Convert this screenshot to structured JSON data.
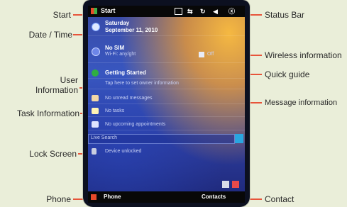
{
  "callouts": {
    "start": "Start",
    "date_time": "Date / Time",
    "user_information_line1": "User",
    "user_information_line2": "Information",
    "task_information": "Task Information",
    "lock_screen": "Lock Screen",
    "phone": "Phone",
    "status_bar": "Status Bar",
    "wireless_information": "Wireless information",
    "quick_guide": "Quick guide",
    "message_information": "Message information",
    "contact": "Contact"
  },
  "device": {
    "start_label": "Start",
    "date_line1": "Saturday",
    "date_line2": "September 11, 2010",
    "wireless_title": "No SIM",
    "wireless_sub": "Wi-Fi: any/ght",
    "wireless_tag": "Off",
    "quick_guide_title": "Getting Started",
    "owner_info": "Tap here to set owner information",
    "messages": "No unread messages",
    "tasks": "No tasks",
    "appointments": "No upcoming appointments",
    "search_placeholder": "Live Search",
    "lock_status": "Device unlocked",
    "softkey_left": "Phone",
    "softkey_right": "Contacts"
  },
  "colors": {
    "callout_line": "#e7543a",
    "background": "#eaeed9"
  }
}
